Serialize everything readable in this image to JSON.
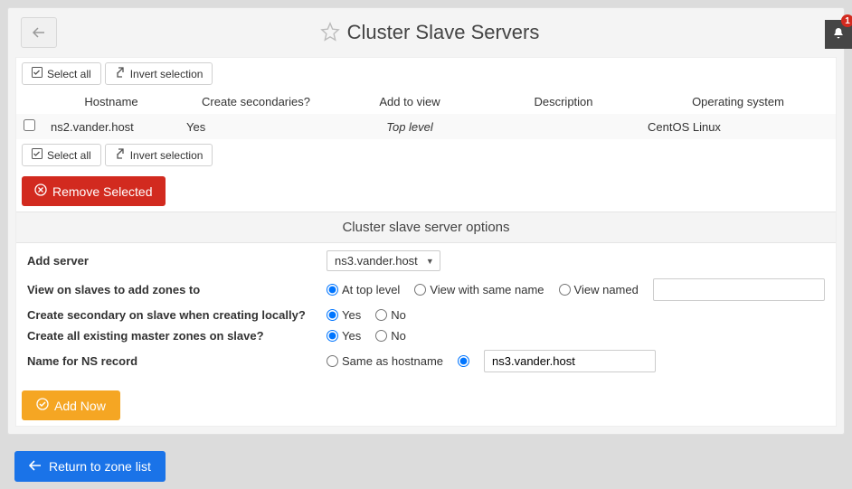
{
  "header": {
    "title": "Cluster Slave Servers"
  },
  "buttons": {
    "select_all": "Select all",
    "invert": "Invert selection",
    "remove": "Remove Selected",
    "add_now": "Add Now",
    "return": "Return to zone list"
  },
  "table": {
    "headers": {
      "hostname": "Hostname",
      "secondaries": "Create secondaries?",
      "view": "Add to view",
      "desc": "Description",
      "os": "Operating system"
    },
    "rows": [
      {
        "hostname": "ns2.vander.host",
        "secondaries": "Yes",
        "view": "Top level",
        "desc": "",
        "os": "CentOS Linux"
      }
    ]
  },
  "options": {
    "title": "Cluster slave server options",
    "labels": {
      "add_server": "Add server",
      "view_slaves": "View on slaves to add zones to",
      "secondary": "Create secondary on slave when creating locally?",
      "all_existing": "Create all existing master zones on slave?",
      "ns_name": "Name for NS record"
    },
    "add_server_value": "ns3.vander.host",
    "view_options": {
      "top": "At top level",
      "same": "View with same name",
      "named": "View named"
    },
    "yesno": {
      "yes": "Yes",
      "no": "No"
    },
    "ns_name_options": {
      "same": "Same as hostname"
    },
    "ns_name_value": "ns3.vander.host"
  },
  "notif": {
    "count": "1"
  }
}
